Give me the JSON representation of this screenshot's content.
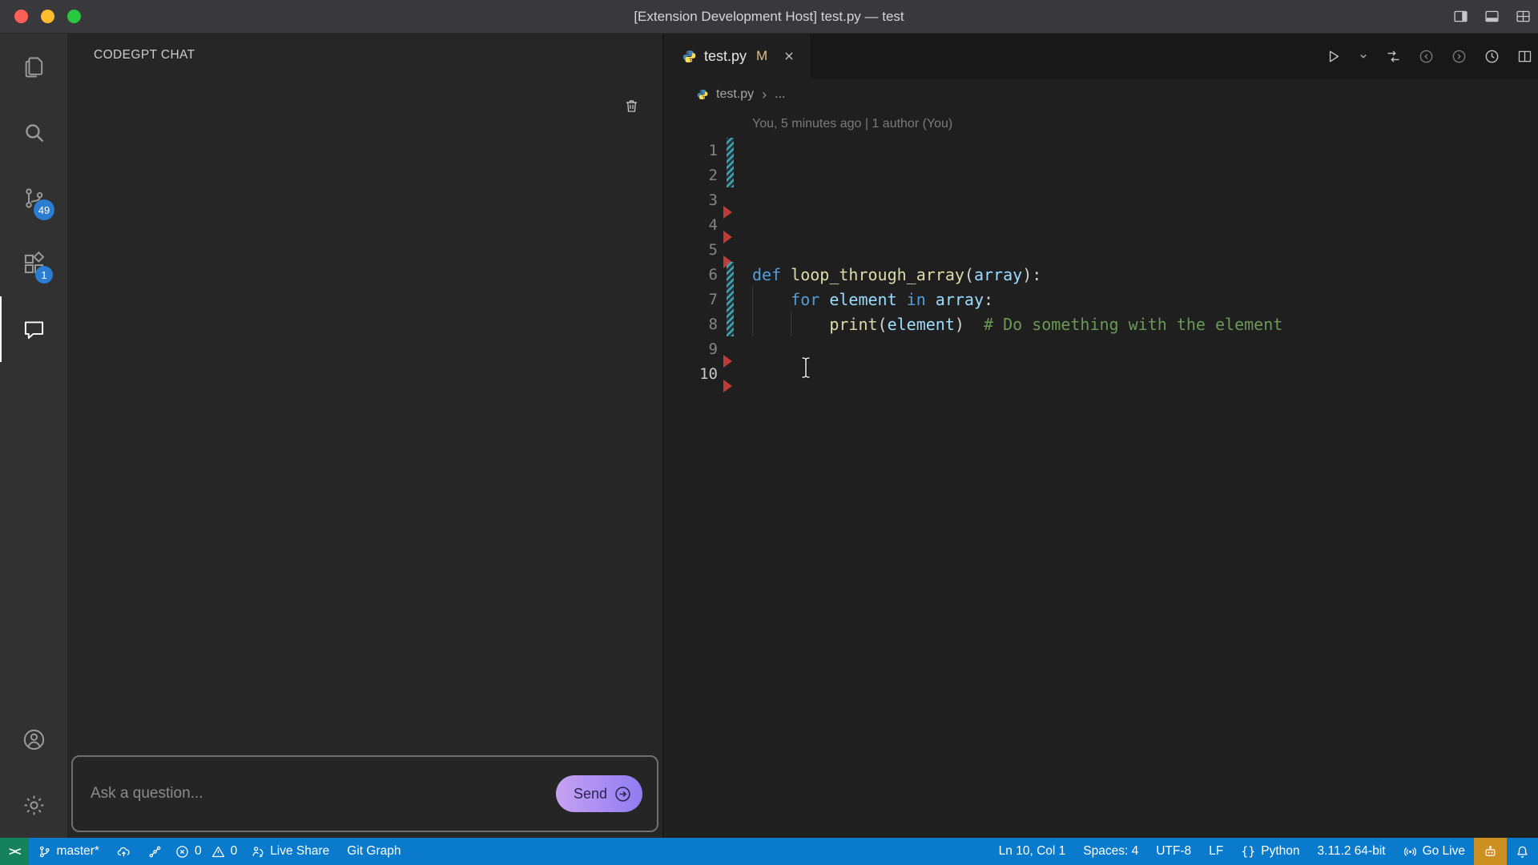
{
  "window": {
    "title": "[Extension Development Host] test.py — test",
    "controls": [
      {
        "name": "close",
        "color": "#ff5f57"
      },
      {
        "name": "minimize",
        "color": "#febc2e"
      },
      {
        "name": "zoom",
        "color": "#28c840"
      }
    ],
    "titlebar_actions": [
      {
        "name": "toggle-secondary-sidebar",
        "icon": "layout-sidebar"
      },
      {
        "name": "toggle-panel",
        "icon": "layout-panel"
      },
      {
        "name": "customize-layout",
        "icon": "layout-grid"
      }
    ]
  },
  "activity_bar": {
    "top_items": [
      {
        "name": "explorer",
        "icon": "files",
        "badge": null,
        "active": false
      },
      {
        "name": "search",
        "icon": "search",
        "badge": null,
        "active": false
      },
      {
        "name": "source-control",
        "icon": "source-control",
        "badge": "49",
        "active": false
      },
      {
        "name": "extensions",
        "icon": "extensions",
        "badge": "1",
        "active": false
      },
      {
        "name": "codegpt-chat",
        "icon": "chat",
        "badge": null,
        "active": true
      }
    ],
    "bottom_items": [
      {
        "name": "accounts",
        "icon": "account"
      },
      {
        "name": "settings",
        "icon": "gear"
      }
    ]
  },
  "sidebar": {
    "title": "CODEGPT CHAT",
    "toolbar": [
      {
        "name": "clear-chat",
        "icon": "trash"
      }
    ],
    "input": {
      "placeholder": "Ask a question...",
      "send_label": "Send"
    }
  },
  "editor": {
    "tab": {
      "label": "test.py",
      "modified_badge": "M",
      "icon": "python"
    },
    "breadcrumb": {
      "file": "test.py",
      "separator": "›",
      "collapsed": "..."
    },
    "codelens": "You, 5 minutes ago | 1 author (You)",
    "toolbar": [
      {
        "name": "run-python-file",
        "icon": "play",
        "dim": false
      },
      {
        "name": "run-dropdown",
        "icon": "chevron-down",
        "dim": false,
        "small": true
      },
      {
        "name": "open-changes",
        "icon": "compare",
        "dim": false
      },
      {
        "name": "previous-change",
        "icon": "circle-left",
        "dim": true
      },
      {
        "name": "next-change",
        "icon": "circle-right",
        "dim": true
      },
      {
        "name": "timeline",
        "icon": "clock",
        "dim": false
      },
      {
        "name": "split-editor",
        "icon": "split",
        "dim": false
      }
    ],
    "lines": [
      {
        "n": 1,
        "marker": "mod",
        "tokens": []
      },
      {
        "n": 2,
        "marker": "mod",
        "tokens": []
      },
      {
        "n": 3,
        "marker": "del",
        "tokens": []
      },
      {
        "n": 4,
        "marker": "del",
        "tokens": []
      },
      {
        "n": 5,
        "marker": "del",
        "tokens": []
      },
      {
        "n": 6,
        "marker": "mod",
        "tokens": [
          {
            "c": "kw",
            "t": "def "
          },
          {
            "c": "fn",
            "t": "loop_through_array"
          },
          {
            "c": "pun",
            "t": "("
          },
          {
            "c": "var",
            "t": "array"
          },
          {
            "c": "pun",
            "t": "):"
          }
        ]
      },
      {
        "n": 7,
        "marker": "mod",
        "guides": [
          0
        ],
        "tokens": [
          {
            "c": "txt",
            "t": "    "
          },
          {
            "c": "kw",
            "t": "for "
          },
          {
            "c": "var",
            "t": "element "
          },
          {
            "c": "kw",
            "t": "in "
          },
          {
            "c": "var",
            "t": "array"
          },
          {
            "c": "pun",
            "t": ":"
          }
        ]
      },
      {
        "n": 8,
        "marker": "mod",
        "guides": [
          0,
          4
        ],
        "tokens": [
          {
            "c": "txt",
            "t": "        "
          },
          {
            "c": "fn",
            "t": "print"
          },
          {
            "c": "pun",
            "t": "("
          },
          {
            "c": "var",
            "t": "element"
          },
          {
            "c": "pun",
            "t": ")"
          },
          {
            "c": "com",
            "t": "  # Do something with the element"
          }
        ]
      },
      {
        "n": 9,
        "marker": "del",
        "tokens": []
      },
      {
        "n": 10,
        "marker": "del",
        "current": true,
        "tokens": []
      }
    ]
  },
  "status_bar": {
    "left": [
      {
        "name": "remote-indicator",
        "icon": "remote",
        "label": "",
        "bg": "#16825d"
      },
      {
        "name": "git-branch",
        "icon": "branch",
        "label": "master*"
      },
      {
        "name": "publish-changes",
        "icon": "cloud-upload",
        "label": ""
      },
      {
        "name": "graph-status",
        "icon": "graph",
        "label": ""
      },
      {
        "name": "error-count",
        "icon": "error",
        "label": "0",
        "tight": true
      },
      {
        "name": "warning-count",
        "icon": "warning",
        "label": "0",
        "tight": true
      },
      {
        "name": "live-share",
        "icon": "live-share",
        "label": "Live Share"
      },
      {
        "name": "git-graph",
        "icon": "",
        "label": "Git Graph"
      }
    ],
    "right": [
      {
        "name": "cursor-position",
        "icon": "",
        "label": "Ln 10, Col 1"
      },
      {
        "name": "indentation",
        "icon": "",
        "label": "Spaces: 4"
      },
      {
        "name": "encoding",
        "icon": "",
        "label": "UTF-8"
      },
      {
        "name": "eol",
        "icon": "",
        "label": "LF"
      },
      {
        "name": "language-mode",
        "icon": "braces",
        "label": "Python"
      },
      {
        "name": "python-interpreter",
        "icon": "",
        "label": "3.11.2 64-bit"
      },
      {
        "name": "go-live",
        "icon": "broadcast",
        "label": "Go Live"
      },
      {
        "name": "codegpt-status",
        "icon": "robot",
        "label": "",
        "bg": "#cc8f21",
        "tile": true
      },
      {
        "name": "notifications",
        "icon": "bell",
        "label": ""
      }
    ]
  },
  "colors": {
    "statusbar": "#0a7acc",
    "remote_tile": "#16825d",
    "activity_badge": "#2a7dd2",
    "modified_tab_badge": "#e2c08d",
    "gutter_modified": "#3aa7b8",
    "gutter_deleted": "#bf3a38",
    "send_gradient_from": "#c7a2f2",
    "send_gradient_to": "#8f7cf1",
    "codegpt_tile": "#cc8f21",
    "token_keyword": "#569cd6",
    "token_variable": "#9cdcfe",
    "token_function": "#dcdcaa",
    "token_comment": "#6a9955"
  }
}
